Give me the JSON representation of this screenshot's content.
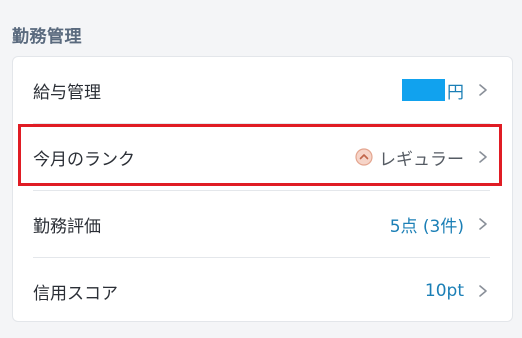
{
  "section": {
    "title": "勤務管理"
  },
  "rows": [
    {
      "label": "給与管理",
      "value": "円"
    },
    {
      "label": "今月のランク",
      "value": "レギュラー"
    },
    {
      "label": "勤務評価",
      "value": "5点 (3件)"
    },
    {
      "label": "信用スコア",
      "value": "10pt"
    }
  ],
  "colors": {
    "value_blue": "#1b7fb6",
    "highlight_red": "#e01c24",
    "redaction_blue": "#11a2ee",
    "rank_icon_fill": "#f6d4c8"
  },
  "icons": {
    "chevron": "chevron-right-icon",
    "rank": "rank-up-icon"
  }
}
